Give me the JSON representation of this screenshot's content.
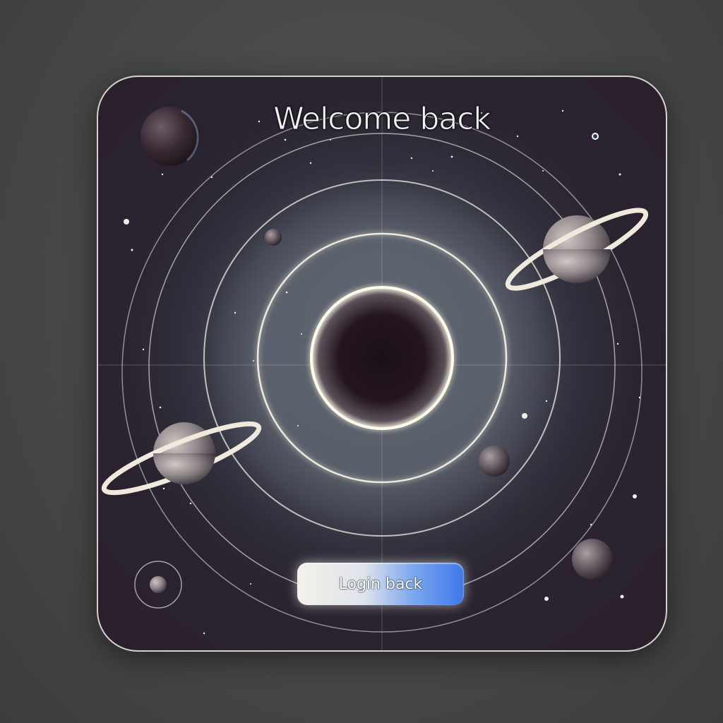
{
  "title": "Welcome back",
  "login_button": {
    "label": "Login back"
  },
  "colors": {
    "card_background": "#2a1f2b",
    "ring_glow": "#fffbe8",
    "button_blue": "#3f78e8",
    "page_background": "#474747"
  },
  "icons": [
    "planet-icon",
    "ringed-planet-icon",
    "moon-icon",
    "star-icon"
  ]
}
